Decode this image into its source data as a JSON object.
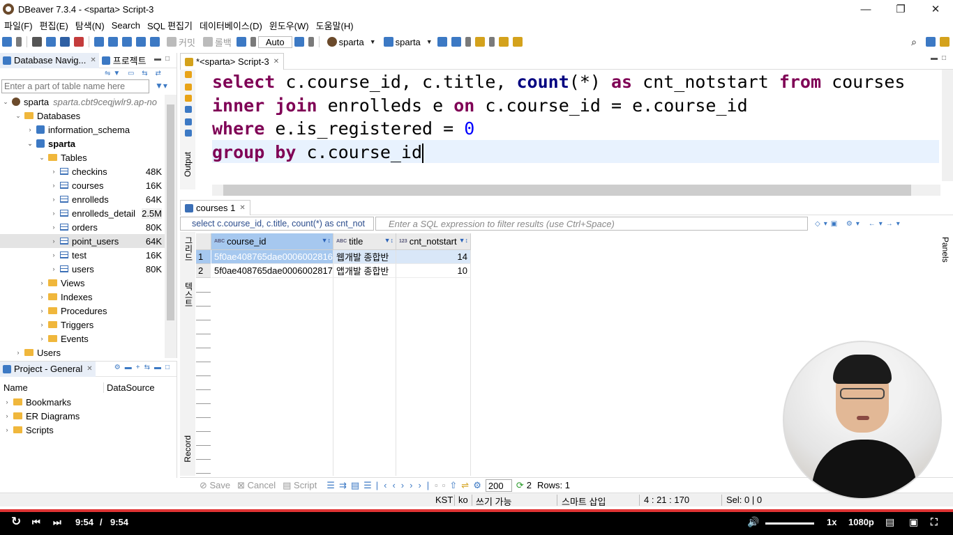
{
  "window": {
    "title": "DBeaver 7.3.4 - <sparta> Script-3",
    "minimize": "—",
    "maximize": "❐",
    "close": "✕"
  },
  "menu": [
    "파일(F)",
    "편집(E)",
    "탐색(N)",
    "Search",
    "SQL 편집기",
    "데이터베이스(D)",
    "윈도우(W)",
    "도움말(H)"
  ],
  "toolbar": {
    "commit_label": "커밋",
    "rollback_label": "롤백",
    "transaction_mode": "Auto",
    "datasource_combo": "sparta",
    "schema_combo": "sparta"
  },
  "navigator": {
    "tab_label": "Database Navig...",
    "projects_tab_label": "프로젝트",
    "filter_placeholder": "Enter a part of table name here",
    "connection": {
      "name": "sparta",
      "host": "sparta.cbt9ceqjwlr9.ap-no"
    },
    "databases_label": "Databases",
    "schemas": [
      "information_schema",
      "sparta"
    ],
    "tables_label": "Tables",
    "tables": [
      {
        "name": "checkins",
        "size": "48K"
      },
      {
        "name": "courses",
        "size": "16K"
      },
      {
        "name": "enrolleds",
        "size": "64K"
      },
      {
        "name": "enrolleds_detail",
        "size": "2.5M"
      },
      {
        "name": "orders",
        "size": "80K"
      },
      {
        "name": "point_users",
        "size": "64K"
      },
      {
        "name": "test",
        "size": "16K"
      },
      {
        "name": "users",
        "size": "80K"
      }
    ],
    "folders": [
      "Views",
      "Indexes",
      "Procedures",
      "Triggers",
      "Events"
    ],
    "users_label": "Users"
  },
  "project": {
    "tab_label": "Project - General",
    "col_name": "Name",
    "col_datasource": "DataSource",
    "items": [
      "Bookmarks",
      "ER Diagrams",
      "Scripts"
    ]
  },
  "editor": {
    "tab_label": "*<sparta> Script-3",
    "output_label": "Output",
    "code": {
      "l1_k1": "select",
      "l1_t1": " c.course_id, c.title, ",
      "l1_fn": "count",
      "l1_t2": "(*) ",
      "l1_k2": "as",
      "l1_t3": " cnt_notstart ",
      "l1_k3": "from",
      "l1_t4": " courses",
      "l2_k1": "inner join",
      "l2_t1": " enrolleds e ",
      "l2_k2": "on",
      "l2_t2": " c.course_id = e.course_id",
      "l3_k1": "where",
      "l3_t1": " e.is_registered = ",
      "l3_num": "0",
      "l4_k1": "group by",
      "l4_t1": " c.course_id"
    }
  },
  "results": {
    "tab_label": "courses 1",
    "query_text": "select c.course_id, c.title, count(*) as cnt_not",
    "filter_placeholder": "Enter a SQL expression to filter results (use Ctrl+Space)",
    "side_labels": {
      "grid": "그리드",
      "text": "텍스트",
      "record": "Record"
    },
    "panels_label": "Panels",
    "columns": [
      "course_id",
      "title",
      "cnt_notstart"
    ],
    "rows": [
      {
        "num": "1",
        "course_id": "5f0ae408765dae0006002816",
        "title": "웹개발 종합반",
        "cnt_notstart": "14"
      },
      {
        "num": "2",
        "course_id": "5f0ae408765dae0006002817",
        "title": "앱개발 종합반",
        "cnt_notstart": "10"
      }
    ],
    "bottom": {
      "save": "Save",
      "cancel": "Cancel",
      "script": "Script",
      "fetch_size": "200",
      "row_count_fetched": "2",
      "rows_label": "Rows: 1"
    }
  },
  "statusbar": {
    "tz": "KST",
    "locale": "ko",
    "mode": "쓰기 가능",
    "insert_mode": "스마트 삽입",
    "position": "4 : 21 : 170",
    "selection": "Sel: 0 | 0"
  },
  "video": {
    "current_time": "9:54",
    "separator": "/",
    "duration": "9:54",
    "speed": "1x",
    "quality": "1080p"
  }
}
